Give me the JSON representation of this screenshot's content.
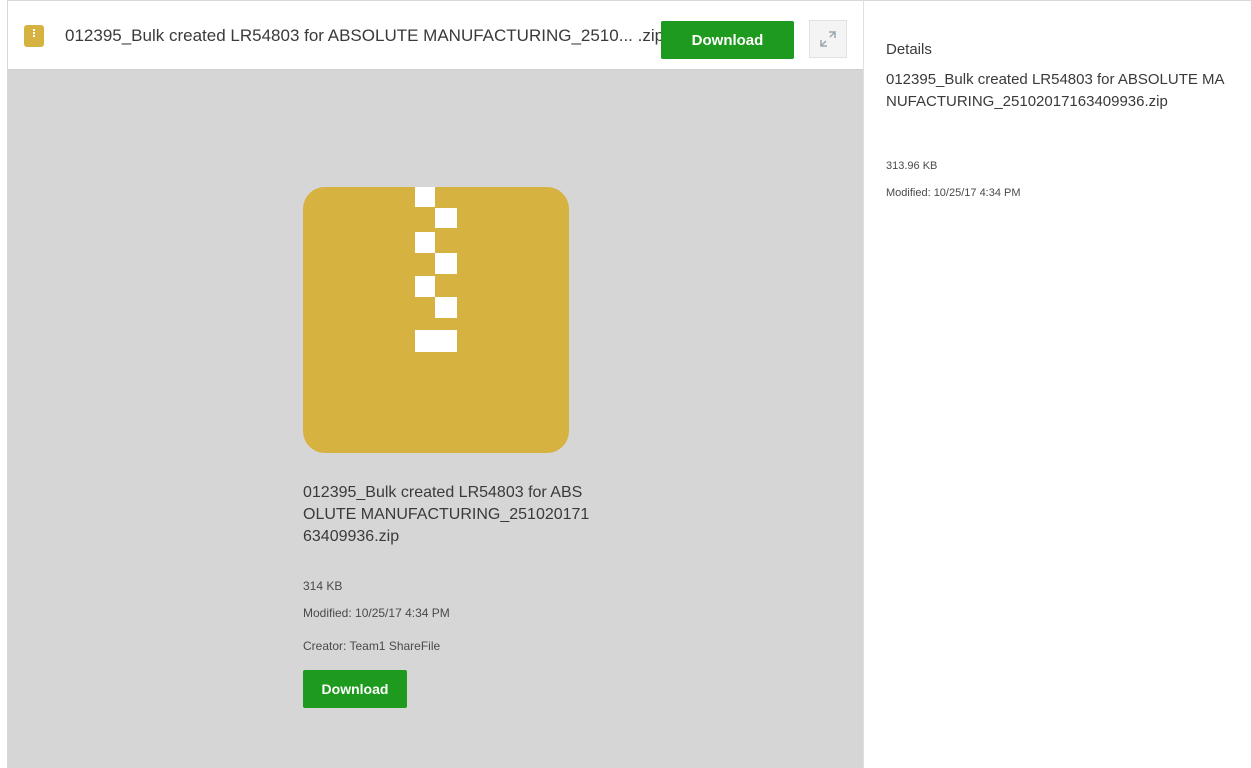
{
  "header": {
    "file_title": "012395_Bulk created LR54803 for ABSOLUTE MANUFACTURING_2510... .zip",
    "download_label": "Download",
    "file_icon": "zip-file-icon",
    "expand_icon": "expand-arrows-icon"
  },
  "preview": {
    "icon": "zip-archive-icon",
    "filename": "012395_Bulk created LR54803 for ABSOLUTE MANUFACTURING_25102017163409936.zip",
    "size": "314 KB",
    "modified": "Modified: 10/25/17 4:34 PM",
    "creator": "Creator: Team1 ShareFile",
    "download_label": "Download"
  },
  "details": {
    "heading": "Details",
    "filename": "012395_Bulk created LR54803 for ABSOLUTE MANUFACTURING_25102017163409936.zip",
    "size": "313.96 KB",
    "modified": "Modified: 10/25/17 4:34 PM"
  },
  "colors": {
    "accent_green": "#1e9a1e",
    "zip_gold": "#d6b241",
    "viewer_bg": "#d6d6d6"
  }
}
